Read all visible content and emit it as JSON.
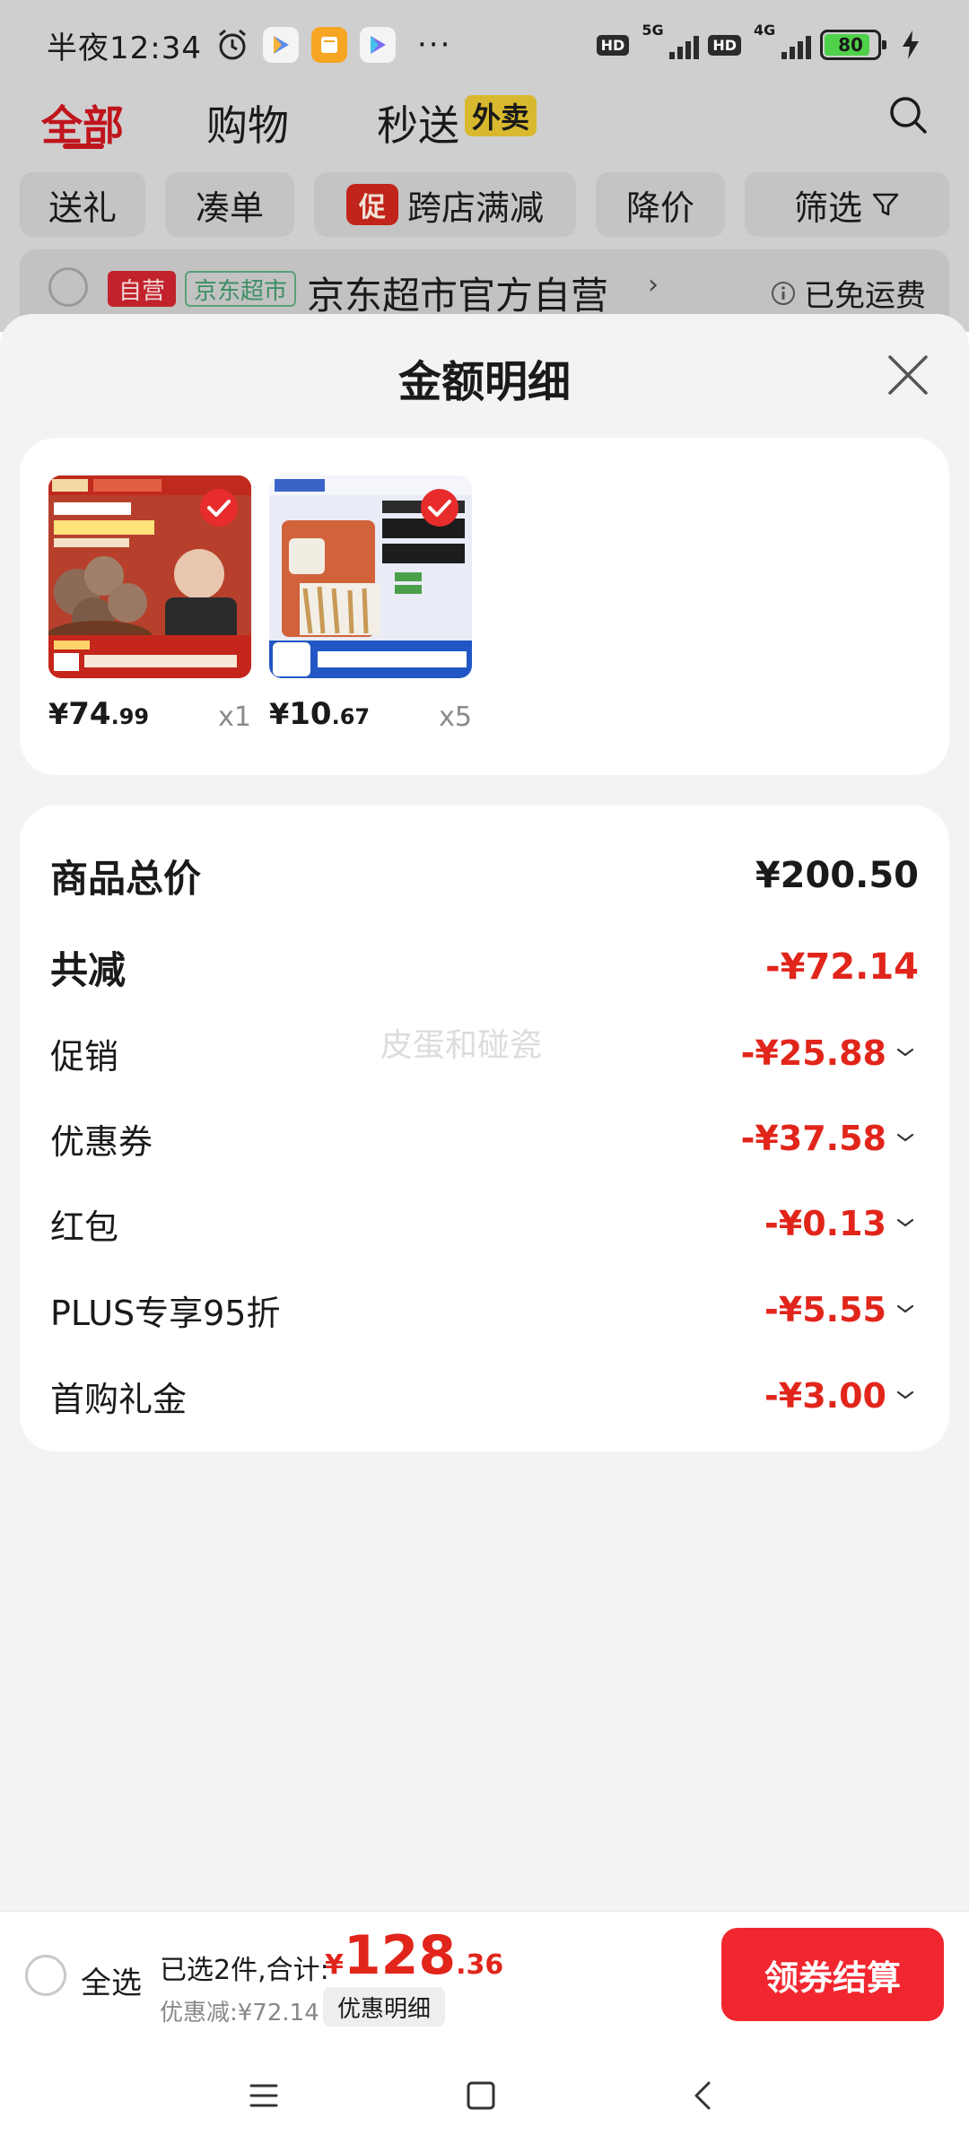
{
  "status_bar": {
    "time": "半夜12:34",
    "more": "···",
    "hd1": "HD",
    "gen1": "5G",
    "hd2": "HD",
    "gen2": "4G",
    "battery": "80"
  },
  "top_tabs": [
    {
      "label": "全部"
    },
    {
      "label": "购物"
    },
    {
      "label": "秒送"
    }
  ],
  "waimai_badge": "外卖",
  "filter_chips": [
    {
      "label": "送礼"
    },
    {
      "label": "凑单"
    },
    {
      "label": "跨店满减"
    },
    {
      "label": "降价"
    },
    {
      "label": "筛选"
    }
  ],
  "promo_icon_text": "促",
  "shop": {
    "self_tag": "自营",
    "mart_tag": "京东超市",
    "name": "京东超市官方自营",
    "chevron": "›",
    "shipping": "已免运费"
  },
  "sheet": {
    "title": "金额明细",
    "watermark": "皮蛋和碰瓷"
  },
  "products": [
    {
      "currency": "¥",
      "price_int": "74",
      "price_dec": ".99",
      "qty": "x1"
    },
    {
      "currency": "¥",
      "price_int": "10",
      "price_dec": ".67",
      "qty": "x5"
    }
  ],
  "summary": {
    "total_label": "商品总价",
    "total_value": "¥200.50",
    "reduce_label": "共减",
    "reduce_value": "-¥72.14",
    "rows": [
      {
        "label": "促销",
        "value": "-¥25.88"
      },
      {
        "label": "优惠券",
        "value": "-¥37.58"
      },
      {
        "label": "红包",
        "value": "-¥0.13"
      },
      {
        "label": "PLUS专享95折",
        "value": "-¥5.55"
      },
      {
        "label": "首购礼金",
        "value": "-¥3.00"
      }
    ]
  },
  "checkout": {
    "select_all": "全选",
    "selected": "已选2件,合计:",
    "currency": "¥",
    "total_int": "128",
    "total_dec": ".36",
    "discount": "优惠减:¥72.14",
    "detail": "优惠明细",
    "button": "领券结算"
  },
  "colors": {
    "accent_red": "#e1251b",
    "button_red": "#f2262f",
    "tab_red": "#c0151d"
  }
}
